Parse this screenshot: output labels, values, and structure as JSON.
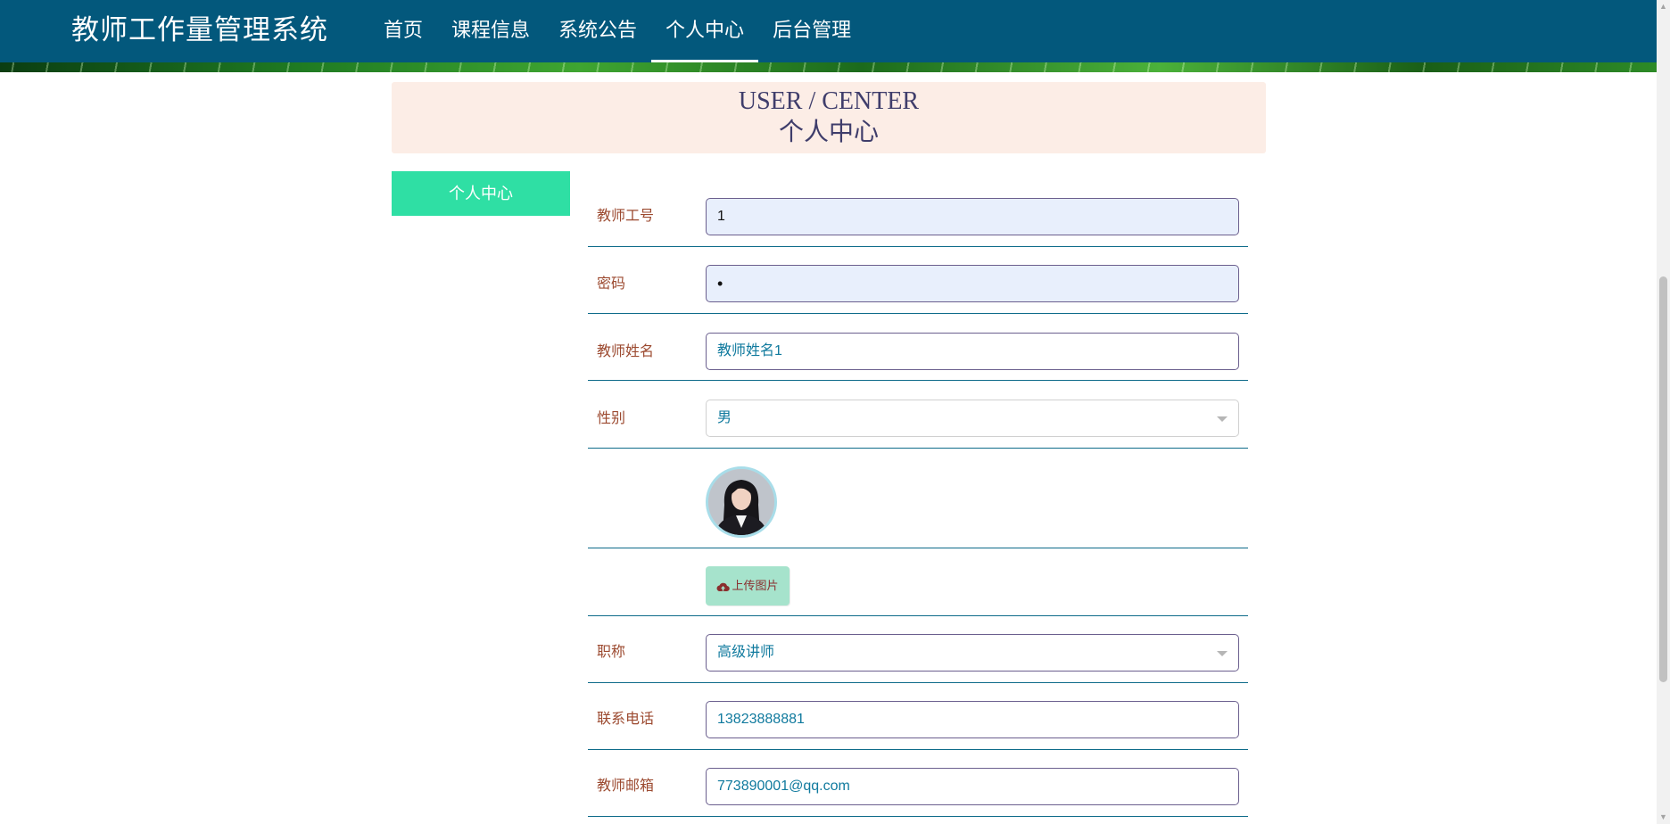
{
  "header": {
    "site_title": "教师工作量管理系统",
    "nav": [
      {
        "label": "首页",
        "active": false
      },
      {
        "label": "课程信息",
        "active": false
      },
      {
        "label": "系统公告",
        "active": false
      },
      {
        "label": "个人中心",
        "active": true
      },
      {
        "label": "后台管理",
        "active": false
      }
    ]
  },
  "page_heading": {
    "english": "USER / CENTER",
    "chinese": "个人中心"
  },
  "side_menu": {
    "items": [
      {
        "label": "个人中心"
      }
    ]
  },
  "form": {
    "teacher_id": {
      "label": "教师工号",
      "value": "1"
    },
    "password": {
      "label": "密码",
      "value": "1"
    },
    "teacher_name": {
      "label": "教师姓名",
      "value": "教师姓名1"
    },
    "gender": {
      "label": "性别",
      "value": "男"
    },
    "avatar": {
      "icon": "user-avatar-photo"
    },
    "upload": {
      "label": "上传图片",
      "icon": "cloud-upload-icon"
    },
    "title": {
      "label": "职称",
      "value": "高级讲师"
    },
    "phone": {
      "label": "联系电话",
      "value": "13823888881"
    },
    "email": {
      "label": "教师邮箱",
      "value": "773890001@qq.com"
    }
  },
  "colors": {
    "header_bg": "#03587c",
    "heading_bg": "#fcede6",
    "menu_active_bg": "#2fdfa4",
    "label_color": "#9c4a30",
    "value_color": "#107a9e",
    "upload_bg": "#a6e3cc"
  }
}
